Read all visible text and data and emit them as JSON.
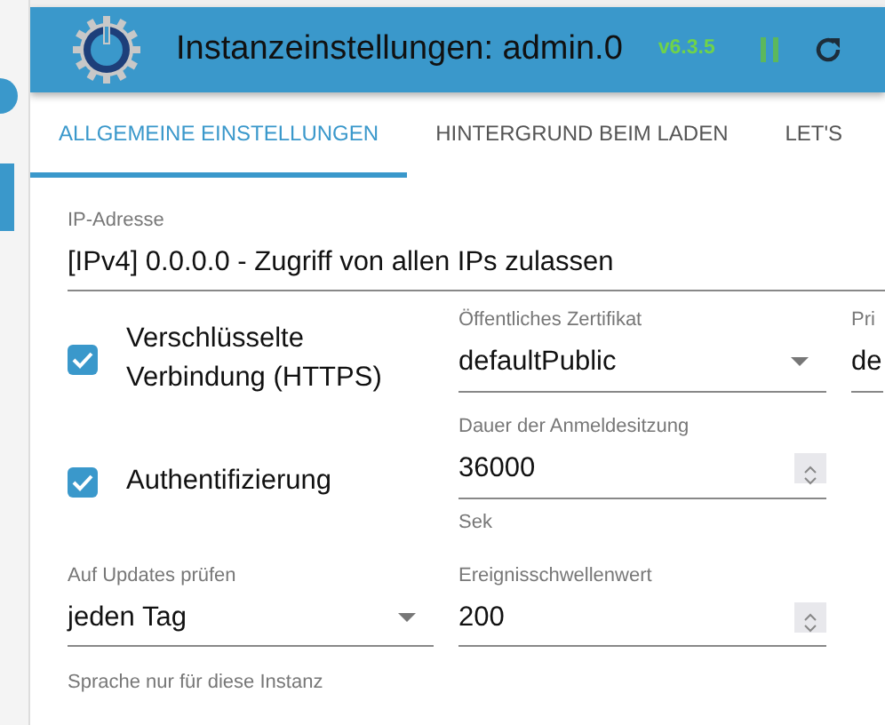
{
  "header": {
    "title": "Instanzeinstellungen: admin.0",
    "version": "v6.3.5"
  },
  "tabs": [
    {
      "label": "ALLGEMEINE EINSTELLUNGEN",
      "selected": true
    },
    {
      "label": "HINTERGRUND BEIM LADEN",
      "selected": false
    },
    {
      "label": "LET'S",
      "selected": false
    }
  ],
  "rows": [
    [
      {
        "kind": "text",
        "label": "IP-Adresse",
        "value": "[IPv4] 0.0.0.0 - Zugriff von allen IPs zulassen"
      }
    ],
    [
      {
        "kind": "checkbox",
        "label": "Verschlüsselte Verbindung (HTTPS)",
        "checked": true
      },
      {
        "kind": "select",
        "label": "Öffentliches Zertifikat",
        "value": "defaultPublic"
      },
      {
        "kind": "select",
        "label": "Pri",
        "value": "de"
      }
    ],
    [
      {
        "kind": "checkbox",
        "label": "Authentifizierung",
        "checked": true
      },
      {
        "kind": "number",
        "label": "Dauer der Anmeldesitzung",
        "value": "36000",
        "helper": "Sek"
      }
    ],
    [
      {
        "kind": "select",
        "label": "Auf Updates prüfen",
        "value": "jeden Tag"
      },
      {
        "kind": "number",
        "label": "Ereignisschwellenwert",
        "value": "200"
      }
    ],
    [
      {
        "kind": "caption",
        "label": "Sprache nur für diese Instanz"
      }
    ]
  ]
}
